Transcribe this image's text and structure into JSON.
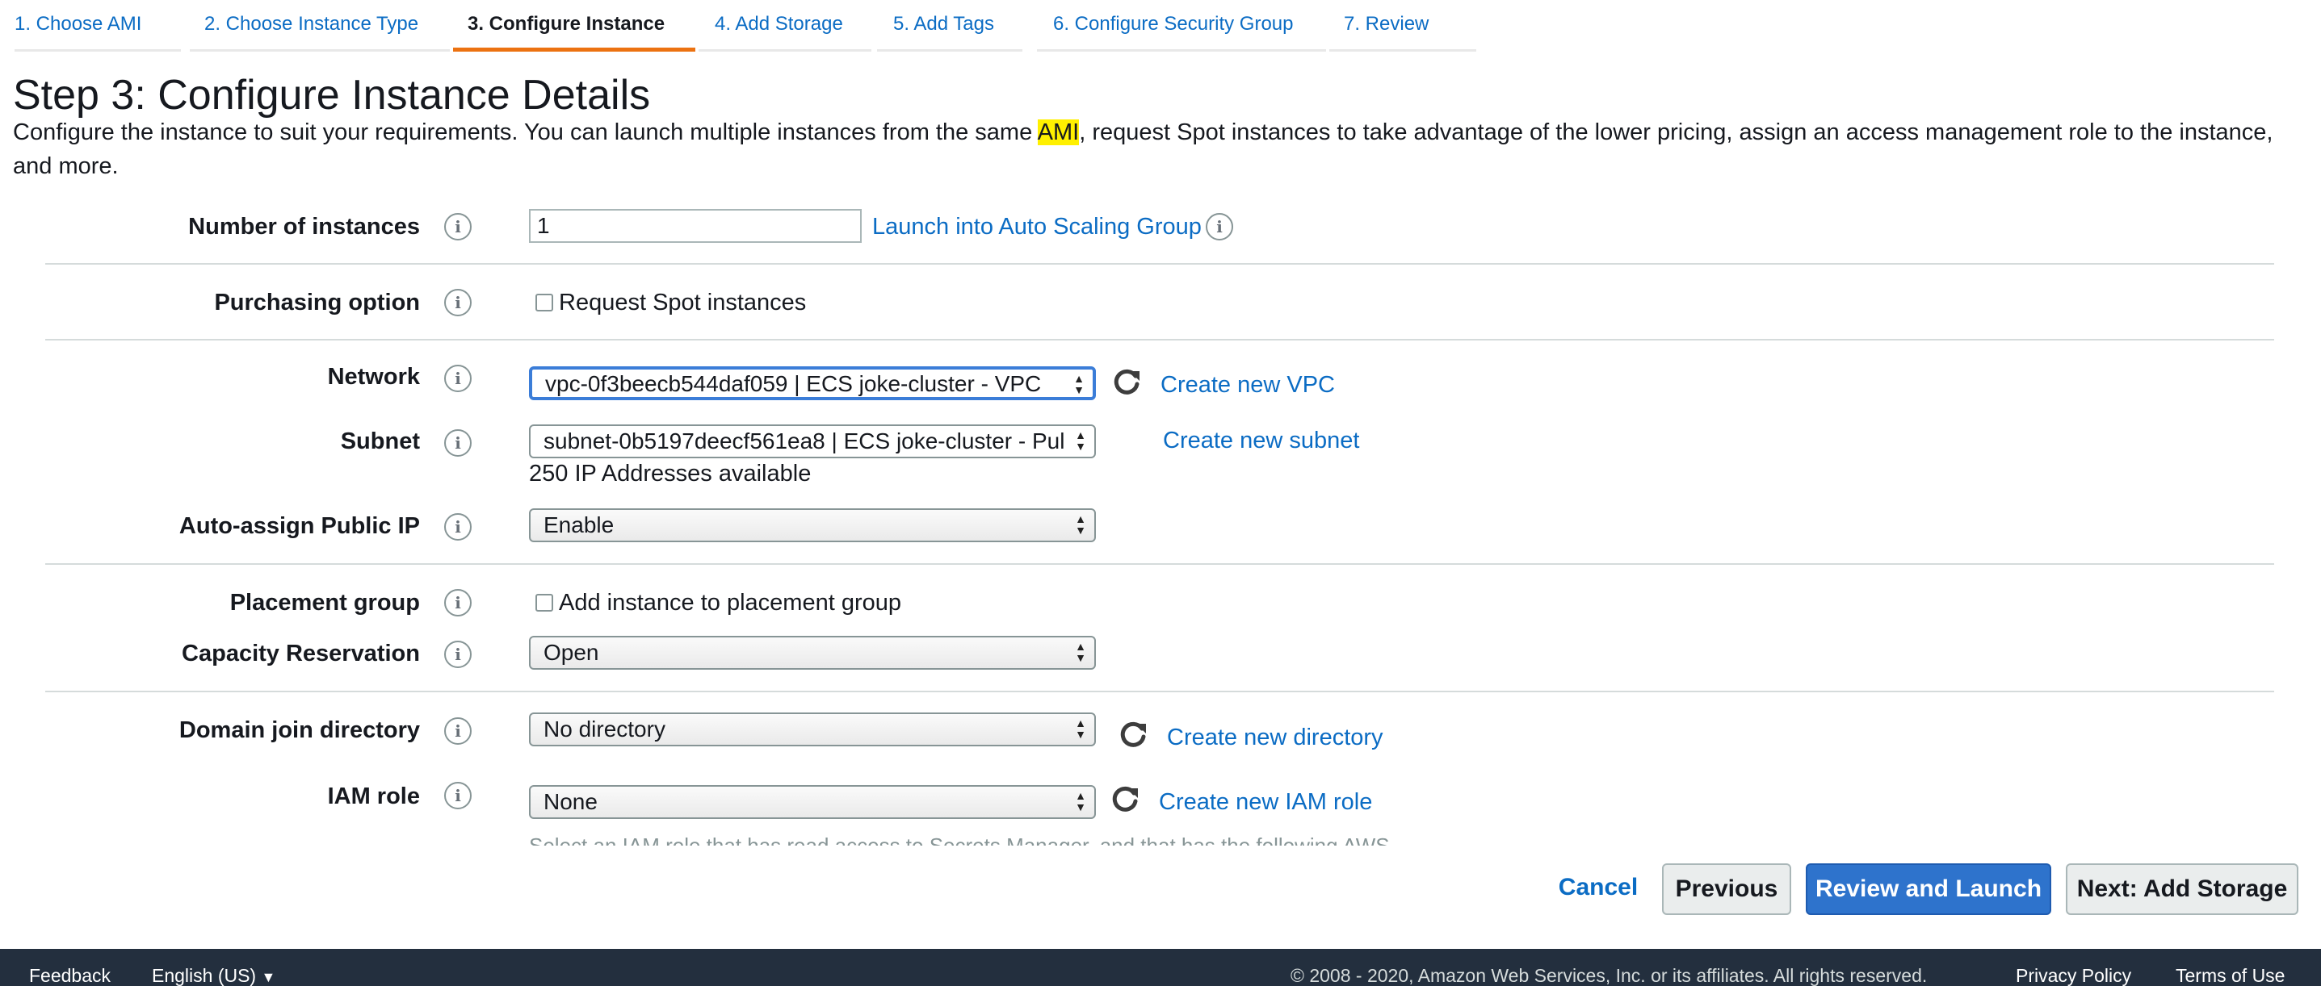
{
  "tabs": [
    {
      "label": "1. Choose AMI"
    },
    {
      "label": "2. Choose Instance Type"
    },
    {
      "label": "3. Configure Instance"
    },
    {
      "label": "4. Add Storage"
    },
    {
      "label": "5. Add Tags"
    },
    {
      "label": "6. Configure Security Group"
    },
    {
      "label": "7. Review"
    }
  ],
  "header": {
    "title": "Step 3: Configure Instance Details",
    "desc_before": "Configure the instance to suit your requirements. You can launch multiple instances from the same ",
    "desc_highlight": "AMI",
    "desc_after": ", request Spot instances to take advantage of the lower pricing, assign an access management role to the instance, and more."
  },
  "form": {
    "instances": {
      "label": "Number of instances",
      "value": "1",
      "link": "Launch into Auto Scaling Group"
    },
    "purchasing": {
      "label": "Purchasing option",
      "checkbox_label": "Request Spot instances"
    },
    "network": {
      "label": "Network",
      "value": "vpc-0f3beecb544daf059 | ECS joke-cluster - VPC",
      "link": "Create new VPC"
    },
    "subnet": {
      "label": "Subnet",
      "value": "subnet-0b5197deecf561ea8 | ECS joke-cluster - Pul",
      "link": "Create new subnet",
      "note": "250 IP Addresses available"
    },
    "public_ip": {
      "label": "Auto-assign Public IP",
      "value": "Enable"
    },
    "placement": {
      "label": "Placement group",
      "checkbox_label": "Add instance to placement group"
    },
    "capacity": {
      "label": "Capacity Reservation",
      "value": "Open"
    },
    "domain": {
      "label": "Domain join directory",
      "value": "No directory",
      "link": "Create new directory"
    },
    "iam": {
      "label": "IAM role",
      "value": "None",
      "link": "Create new IAM role",
      "hint": "Select an IAM role that has read access to Secrets Manager, and that has the following AWS"
    }
  },
  "actions": {
    "cancel": "Cancel",
    "previous": "Previous",
    "review": "Review and Launch",
    "next": "Next: Add Storage"
  },
  "footer": {
    "feedback": "Feedback",
    "language": "English (US)",
    "copyright": "© 2008 - 2020, Amazon Web Services, Inc. or its affiliates. All rights reserved.",
    "privacy": "Privacy Policy",
    "terms": "Terms of Use"
  },
  "colors": {
    "accent": "#ec7211",
    "link": "#0b6cc4",
    "primary": "#2e73cc",
    "footer": "#232f3e"
  }
}
